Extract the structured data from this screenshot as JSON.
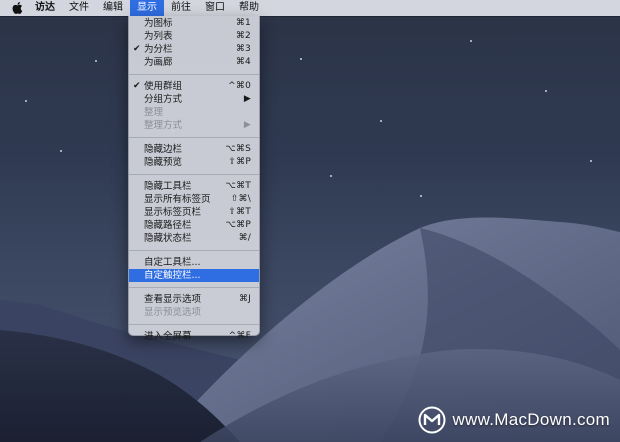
{
  "menubar": {
    "apple": "apple-icon",
    "items": [
      {
        "label": "访达"
      },
      {
        "label": "文件"
      },
      {
        "label": "编辑"
      },
      {
        "label": "显示",
        "active": true
      },
      {
        "label": "前往"
      },
      {
        "label": "窗口"
      },
      {
        "label": "帮助"
      }
    ]
  },
  "view_menu": {
    "items": [
      {
        "label": "为图标",
        "shortcut": "⌘1"
      },
      {
        "label": "为列表",
        "shortcut": "⌘2"
      },
      {
        "label": "为分栏",
        "shortcut": "⌘3",
        "checked": true
      },
      {
        "label": "为画廊",
        "shortcut": "⌘4"
      },
      {
        "label": "使用群组",
        "shortcut": "^⌘0",
        "checked": true
      },
      {
        "label": "分组方式",
        "shortcut": "▶"
      },
      {
        "label": "整理",
        "shortcut": "",
        "disabled": true
      },
      {
        "label": "整理方式",
        "shortcut": "▶",
        "disabled": true
      },
      {
        "label": "隐藏边栏",
        "shortcut": "⌥⌘S"
      },
      {
        "label": "隐藏预览",
        "shortcut": "⇧⌘P"
      },
      {
        "label": "隐藏工具栏",
        "shortcut": "⌥⌘T"
      },
      {
        "label": "显示所有标签页",
        "shortcut": "⇧⌘\\"
      },
      {
        "label": "显示标签页栏",
        "shortcut": "⇧⌘T"
      },
      {
        "label": "隐藏路径栏",
        "shortcut": "⌥⌘P"
      },
      {
        "label": "隐藏状态栏",
        "shortcut": "⌘/"
      },
      {
        "label": "自定工具栏...",
        "shortcut": ""
      },
      {
        "label": "自定触控栏...",
        "shortcut": "",
        "highlighted": true
      },
      {
        "label": "查看显示选项",
        "shortcut": "⌘J"
      },
      {
        "label": "显示预览选项",
        "shortcut": "",
        "disabled": true
      },
      {
        "label": "进入全屏幕",
        "shortcut": "^⌘F"
      }
    ]
  },
  "watermark": {
    "text": "www.MacDown.com",
    "logo": "macdown-logo-icon"
  },
  "colors": {
    "accent": "#2f6de3",
    "menu_bg": "#d4d6de",
    "disabled_text": "#8c8f98"
  }
}
